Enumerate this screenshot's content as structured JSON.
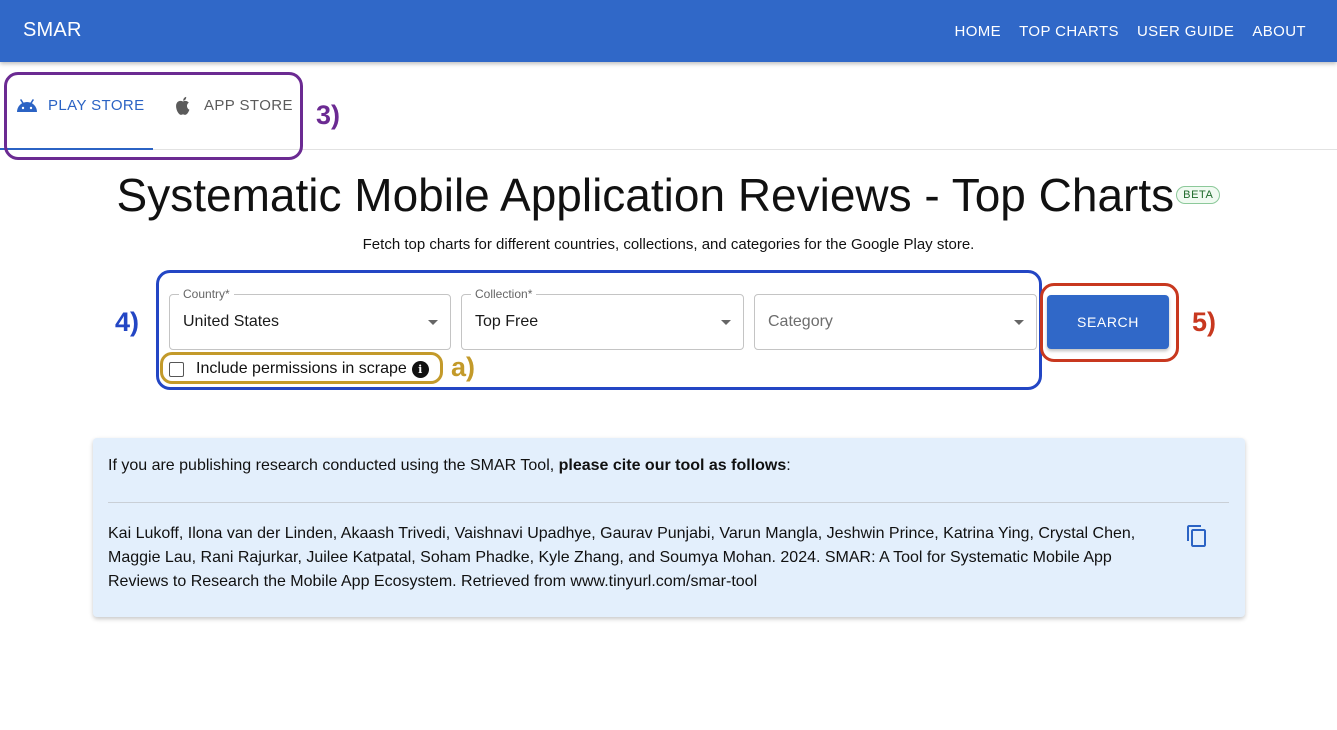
{
  "app": {
    "brand": "SMAR"
  },
  "nav": {
    "items": [
      "HOME",
      "TOP CHARTS",
      "USER GUIDE",
      "ABOUT"
    ]
  },
  "tabs": [
    {
      "label": "PLAY STORE",
      "icon": "android-icon",
      "selected": true
    },
    {
      "label": "APP STORE",
      "icon": "apple-icon",
      "selected": false
    }
  ],
  "annotations": {
    "tabs": "3)",
    "form": "4)",
    "checkbox": "a)",
    "search": "5)"
  },
  "page": {
    "title": "Systematic Mobile Application Reviews - Top Charts",
    "badge": "BETA",
    "subtitle": "Fetch top charts for different countries, collections, and categories for the Google Play store."
  },
  "form": {
    "country": {
      "label": "Country*",
      "value": "United States"
    },
    "collection": {
      "label": "Collection*",
      "value": "Top Free"
    },
    "category": {
      "placeholder": "Category",
      "value": ""
    },
    "permissions": {
      "label": "Include permissions in scrape",
      "checked": false
    },
    "search_label": "SEARCH"
  },
  "citation": {
    "intro_prefix": "If you are publishing research conducted using the SMAR Tool, ",
    "intro_bold": "please cite our tool as follows",
    "intro_suffix": ":",
    "text": "Kai Lukoff, Ilona van der Linden, Akaash Trivedi, Vaishnavi Upadhye, Gaurav Punjabi, Varun Mangla, Jeshwin Prince, Katrina Ying, Crystal Chen, Maggie Lau, Rani Rajurkar, Juilee Katpatal, Soham Phadke, Kyle Zhang, and Soumya Mohan. 2024. SMAR: A Tool for Systematic Mobile App Reviews to Research the Mobile App Ecosystem. Retrieved from www.tinyurl.com/smar-tool",
    "copy_icon": "copy-icon"
  },
  "colors": {
    "primary": "#3068c8",
    "purple": "#6b2a92",
    "blue": "#2346c4",
    "gold": "#c39a2a",
    "red": "#c8381f",
    "card": "#e3effc"
  }
}
